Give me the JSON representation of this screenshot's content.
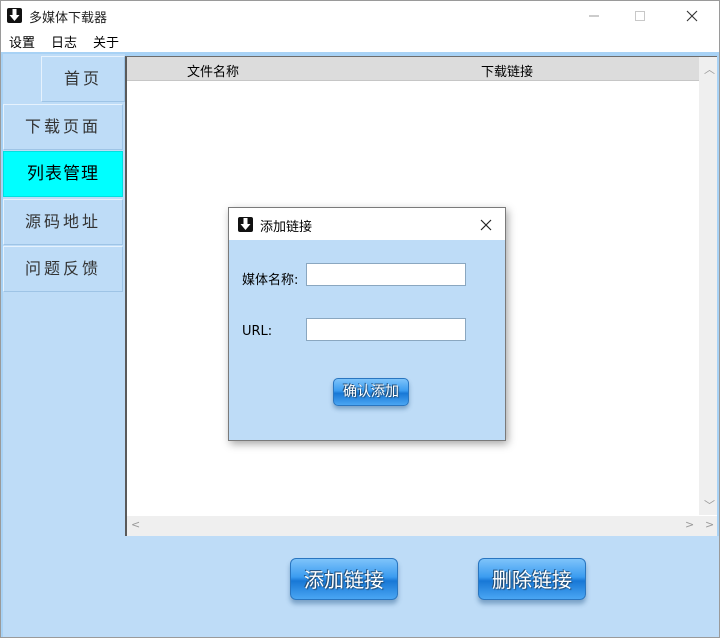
{
  "window": {
    "title": "多媒体下载器",
    "icon": "download-arrow-icon"
  },
  "menu": [
    "设置",
    "日志",
    "关于"
  ],
  "sidebar": {
    "items": [
      {
        "label": "首页"
      },
      {
        "label": "下载页面"
      },
      {
        "label": "列表管理",
        "active": true
      },
      {
        "label": "源码地址"
      },
      {
        "label": "问题反馈"
      }
    ],
    "active_color": "#00ffff"
  },
  "table": {
    "columns": [
      "文件名称",
      "下载链接"
    ],
    "rows": []
  },
  "actions": {
    "add_label": "添加链接",
    "delete_label": "删除链接"
  },
  "dialog": {
    "title": "添加链接",
    "name_label": "媒体名称:",
    "name_value": "",
    "url_label": "URL:",
    "url_value": "",
    "confirm_label": "确认添加"
  },
  "colors": {
    "background": "#a8d2f5",
    "panel": "#bedcf7",
    "button": "#3b9cf0"
  }
}
